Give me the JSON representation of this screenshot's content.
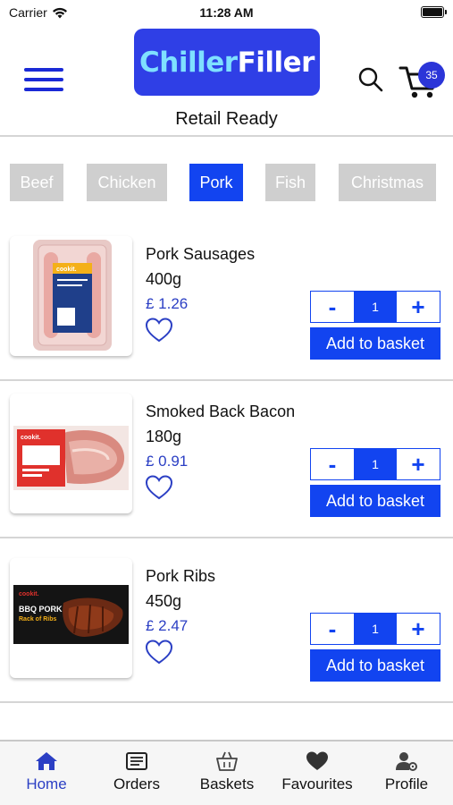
{
  "status_bar": {
    "carrier": "Carrier",
    "time": "11:28 AM"
  },
  "header": {
    "logo_part1": "Chiller",
    "logo_part2": "Filler",
    "subtitle": "Retail Ready",
    "cart_count": "35"
  },
  "categories": [
    {
      "label": "Beef",
      "active": false
    },
    {
      "label": "Chicken",
      "active": false
    },
    {
      "label": "Pork",
      "active": true
    },
    {
      "label": "Fish",
      "active": false
    },
    {
      "label": "Christmas",
      "active": false
    }
  ],
  "products": [
    {
      "name": "Pork Sausages",
      "weight": "400g",
      "price": "£ 1.26",
      "quantity": "1",
      "add_label": "Add to basket",
      "minus": "-",
      "plus": "+",
      "image_icon": "sausages-pack-image",
      "brand": "cookit."
    },
    {
      "name": "Smoked Back Bacon",
      "weight": "180g",
      "price": "£ 0.91",
      "quantity": "1",
      "add_label": "Add to basket",
      "minus": "-",
      "plus": "+",
      "image_icon": "bacon-pack-image",
      "brand": "cookit."
    },
    {
      "name": "Pork Ribs",
      "weight": "450g",
      "price": "£ 2.47",
      "quantity": "1",
      "add_label": "Add to basket",
      "minus": "-",
      "plus": "+",
      "image_icon": "ribs-pack-image",
      "brand": "cookit.",
      "pack_text_1": "BBQ PORK",
      "pack_text_2": "Rack of Ribs"
    }
  ],
  "tabbar": [
    {
      "label": "Home",
      "icon": "home-icon",
      "active": true
    },
    {
      "label": "Orders",
      "icon": "orders-icon",
      "active": false
    },
    {
      "label": "Baskets",
      "icon": "basket-icon",
      "active": false
    },
    {
      "label": "Favourites",
      "icon": "heart-icon",
      "active": false
    },
    {
      "label": "Profile",
      "icon": "profile-icon",
      "active": false
    }
  ],
  "colors": {
    "primary": "#1244f0",
    "logo_bg": "#2f3fe6",
    "logo_accent": "#7fe0ff",
    "price": "#2b3fc4",
    "category_inactive": "#cfcfcf"
  }
}
